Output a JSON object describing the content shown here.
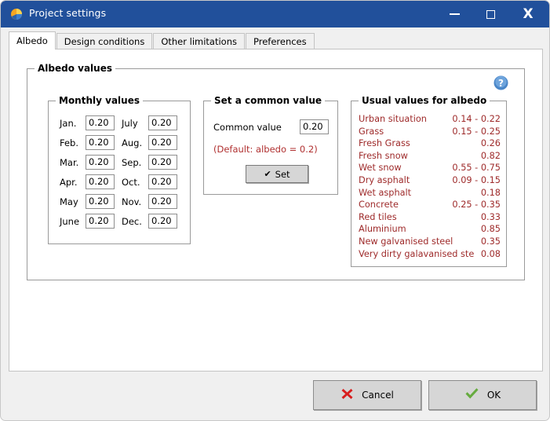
{
  "window": {
    "title": "Project settings",
    "icon": "sun-pie-icon",
    "controls": {
      "minimize": "minimize-icon",
      "maximize": "maximize-icon",
      "close": "X"
    },
    "titlebar_color": "#21509b"
  },
  "tabs": [
    {
      "label": "Albedo",
      "active": true
    },
    {
      "label": "Design conditions",
      "active": false
    },
    {
      "label": "Other limitations",
      "active": false
    },
    {
      "label": "Preferences",
      "active": false
    }
  ],
  "outer_group": {
    "label": "Albedo values"
  },
  "help": {
    "icon": "help-icon",
    "glyph": "?"
  },
  "monthly": {
    "label": "Monthly values",
    "rows": [
      {
        "left_label": "Jan.",
        "left_value": "0.20",
        "right_label": "July",
        "right_value": "0.20"
      },
      {
        "left_label": "Feb.",
        "left_value": "0.20",
        "right_label": "Aug.",
        "right_value": "0.20"
      },
      {
        "left_label": "Mar.",
        "left_value": "0.20",
        "right_label": "Sep.",
        "right_value": "0.20"
      },
      {
        "left_label": "Apr.",
        "left_value": "0.20",
        "right_label": "Oct.",
        "right_value": "0.20"
      },
      {
        "left_label": "May",
        "left_value": "0.20",
        "right_label": "Nov.",
        "right_value": "0.20"
      },
      {
        "left_label": "June",
        "left_value": "0.20",
        "right_label": "Dec.",
        "right_value": "0.20"
      }
    ]
  },
  "common": {
    "label": "Set a common value",
    "field_label": "Common value",
    "value": "0.20",
    "default_note": "(Default: albedo = 0.2)",
    "set_button": "Set",
    "set_icon": "check-icon"
  },
  "usual": {
    "label": "Usual values for albedo",
    "text_color": "#9e2a2a",
    "rows": [
      {
        "name": "Urban situation",
        "value": "0.14 - 0.22"
      },
      {
        "name": "Grass",
        "value": "0.15 - 0.25"
      },
      {
        "name": "Fresh Grass",
        "value": "0.26"
      },
      {
        "name": "Fresh snow",
        "value": "0.82"
      },
      {
        "name": "Wet snow",
        "value": "0.55 - 0.75"
      },
      {
        "name": "Dry asphalt",
        "value": "0.09 - 0.15"
      },
      {
        "name": "Wet asphalt",
        "value": "0.18"
      },
      {
        "name": "Concrete",
        "value": "0.25 - 0.35"
      },
      {
        "name": "Red tiles",
        "value": "0.33"
      },
      {
        "name": "Aluminium",
        "value": "0.85"
      },
      {
        "name": "New galvanised steel",
        "value": "0.35"
      },
      {
        "name": "Very dirty galavanised ste",
        "value": "0.08"
      }
    ]
  },
  "footer": {
    "cancel_label": "Cancel",
    "cancel_icon": "red-x-icon",
    "ok_label": "OK",
    "ok_icon": "green-check-icon"
  }
}
